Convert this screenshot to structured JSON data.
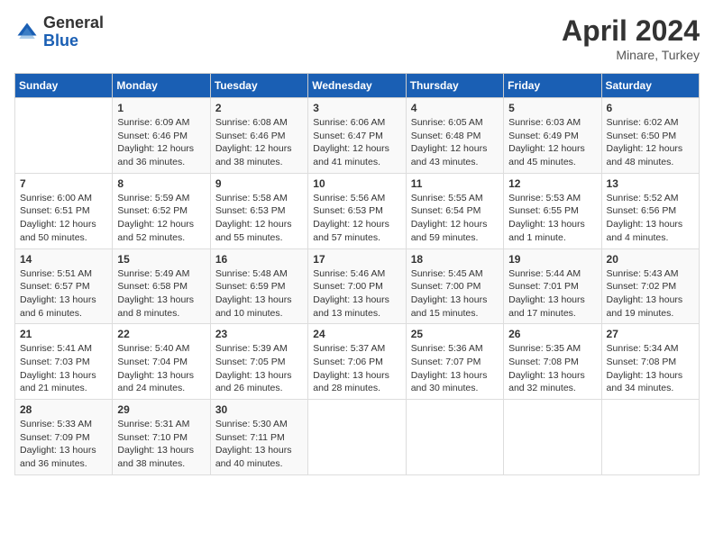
{
  "header": {
    "logo_line1": "General",
    "logo_line2": "Blue",
    "title": "April 2024",
    "subtitle": "Minare, Turkey"
  },
  "days_of_week": [
    "Sunday",
    "Monday",
    "Tuesday",
    "Wednesday",
    "Thursday",
    "Friday",
    "Saturday"
  ],
  "weeks": [
    [
      {
        "day": "",
        "info": ""
      },
      {
        "day": "1",
        "info": "Sunrise: 6:09 AM\nSunset: 6:46 PM\nDaylight: 12 hours\nand 36 minutes."
      },
      {
        "day": "2",
        "info": "Sunrise: 6:08 AM\nSunset: 6:46 PM\nDaylight: 12 hours\nand 38 minutes."
      },
      {
        "day": "3",
        "info": "Sunrise: 6:06 AM\nSunset: 6:47 PM\nDaylight: 12 hours\nand 41 minutes."
      },
      {
        "day": "4",
        "info": "Sunrise: 6:05 AM\nSunset: 6:48 PM\nDaylight: 12 hours\nand 43 minutes."
      },
      {
        "day": "5",
        "info": "Sunrise: 6:03 AM\nSunset: 6:49 PM\nDaylight: 12 hours\nand 45 minutes."
      },
      {
        "day": "6",
        "info": "Sunrise: 6:02 AM\nSunset: 6:50 PM\nDaylight: 12 hours\nand 48 minutes."
      }
    ],
    [
      {
        "day": "7",
        "info": "Sunrise: 6:00 AM\nSunset: 6:51 PM\nDaylight: 12 hours\nand 50 minutes."
      },
      {
        "day": "8",
        "info": "Sunrise: 5:59 AM\nSunset: 6:52 PM\nDaylight: 12 hours\nand 52 minutes."
      },
      {
        "day": "9",
        "info": "Sunrise: 5:58 AM\nSunset: 6:53 PM\nDaylight: 12 hours\nand 55 minutes."
      },
      {
        "day": "10",
        "info": "Sunrise: 5:56 AM\nSunset: 6:53 PM\nDaylight: 12 hours\nand 57 minutes."
      },
      {
        "day": "11",
        "info": "Sunrise: 5:55 AM\nSunset: 6:54 PM\nDaylight: 12 hours\nand 59 minutes."
      },
      {
        "day": "12",
        "info": "Sunrise: 5:53 AM\nSunset: 6:55 PM\nDaylight: 13 hours\nand 1 minute."
      },
      {
        "day": "13",
        "info": "Sunrise: 5:52 AM\nSunset: 6:56 PM\nDaylight: 13 hours\nand 4 minutes."
      }
    ],
    [
      {
        "day": "14",
        "info": "Sunrise: 5:51 AM\nSunset: 6:57 PM\nDaylight: 13 hours\nand 6 minutes."
      },
      {
        "day": "15",
        "info": "Sunrise: 5:49 AM\nSunset: 6:58 PM\nDaylight: 13 hours\nand 8 minutes."
      },
      {
        "day": "16",
        "info": "Sunrise: 5:48 AM\nSunset: 6:59 PM\nDaylight: 13 hours\nand 10 minutes."
      },
      {
        "day": "17",
        "info": "Sunrise: 5:46 AM\nSunset: 7:00 PM\nDaylight: 13 hours\nand 13 minutes."
      },
      {
        "day": "18",
        "info": "Sunrise: 5:45 AM\nSunset: 7:00 PM\nDaylight: 13 hours\nand 15 minutes."
      },
      {
        "day": "19",
        "info": "Sunrise: 5:44 AM\nSunset: 7:01 PM\nDaylight: 13 hours\nand 17 minutes."
      },
      {
        "day": "20",
        "info": "Sunrise: 5:43 AM\nSunset: 7:02 PM\nDaylight: 13 hours\nand 19 minutes."
      }
    ],
    [
      {
        "day": "21",
        "info": "Sunrise: 5:41 AM\nSunset: 7:03 PM\nDaylight: 13 hours\nand 21 minutes."
      },
      {
        "day": "22",
        "info": "Sunrise: 5:40 AM\nSunset: 7:04 PM\nDaylight: 13 hours\nand 24 minutes."
      },
      {
        "day": "23",
        "info": "Sunrise: 5:39 AM\nSunset: 7:05 PM\nDaylight: 13 hours\nand 26 minutes."
      },
      {
        "day": "24",
        "info": "Sunrise: 5:37 AM\nSunset: 7:06 PM\nDaylight: 13 hours\nand 28 minutes."
      },
      {
        "day": "25",
        "info": "Sunrise: 5:36 AM\nSunset: 7:07 PM\nDaylight: 13 hours\nand 30 minutes."
      },
      {
        "day": "26",
        "info": "Sunrise: 5:35 AM\nSunset: 7:08 PM\nDaylight: 13 hours\nand 32 minutes."
      },
      {
        "day": "27",
        "info": "Sunrise: 5:34 AM\nSunset: 7:08 PM\nDaylight: 13 hours\nand 34 minutes."
      }
    ],
    [
      {
        "day": "28",
        "info": "Sunrise: 5:33 AM\nSunset: 7:09 PM\nDaylight: 13 hours\nand 36 minutes."
      },
      {
        "day": "29",
        "info": "Sunrise: 5:31 AM\nSunset: 7:10 PM\nDaylight: 13 hours\nand 38 minutes."
      },
      {
        "day": "30",
        "info": "Sunrise: 5:30 AM\nSunset: 7:11 PM\nDaylight: 13 hours\nand 40 minutes."
      },
      {
        "day": "",
        "info": ""
      },
      {
        "day": "",
        "info": ""
      },
      {
        "day": "",
        "info": ""
      },
      {
        "day": "",
        "info": ""
      }
    ]
  ]
}
